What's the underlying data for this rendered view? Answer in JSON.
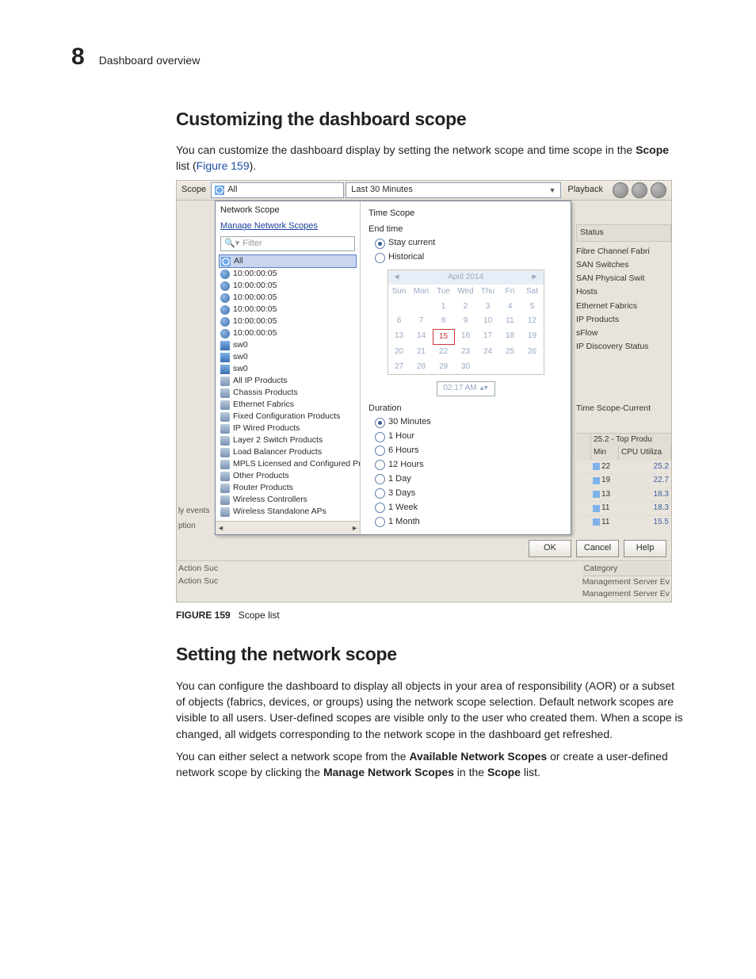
{
  "header": {
    "chapter": "8",
    "title": "Dashboard overview"
  },
  "h2a": "Customizing the dashboard scope",
  "p1a": "You can customize the dashboard display by setting the network scope and time scope in the ",
  "p1b": "Scope",
  "p1c": " list (",
  "p1link": "Figure 159",
  "p1d": ").",
  "fig": {
    "label": "FIGURE 159",
    "caption": "Scope list"
  },
  "h2b": "Setting the network scope",
  "p2": "You can configure the dashboard to display all objects in your area of responsibility (AOR) or a subset of objects (fabrics, devices, or groups) using the network scope selection. Default network scopes are visible to all users. User-defined scopes are visible only to the user who created them. When a scope is changed, all widgets corresponding to the network scope in the dashboard get refreshed.",
  "p3a": "You can either select a network scope from the ",
  "p3b": "Available Network Scopes",
  "p3c": " or create a user-defined network scope by clicking the ",
  "p3d": "Manage Network Scopes",
  "p3e": " in the ",
  "p3f": "Scope",
  "p3g": " list.",
  "ui": {
    "topbar": {
      "scope_label": "Scope",
      "scope_value": "All",
      "time_value": "Last 30 Minutes",
      "playback_label": "Playback"
    },
    "ns": {
      "title": "Network Scope",
      "manage": "Manage Network Scopes",
      "filter_placeholder": "Filter",
      "all": "All",
      "fabrics": [
        "10:00:00:05",
        "10:00:00:05",
        "10:00:00:05",
        "10:00:00:05",
        "10:00:00:05",
        "10:00:00:05"
      ],
      "sw": [
        "sw0",
        "sw0",
        "sw0"
      ],
      "cats": [
        "All IP Products",
        "Chassis Products",
        "Ethernet Fabrics",
        "Fixed Configuration Products",
        "IP Wired Products",
        "Layer 2 Switch Products",
        "Load Balancer Products",
        "MPLS Licensed and Configured Pro",
        "Other Products",
        "Router Products",
        "Wireless Controllers",
        "Wireless Standalone APs"
      ]
    },
    "ts": {
      "title": "Time Scope",
      "endtime": "End time",
      "stay": "Stay current",
      "hist": "Historical",
      "month": "April 2014",
      "dow": [
        "Sun",
        "Mon",
        "Tue",
        "Wed",
        "Thu",
        "Fri",
        "Sat"
      ],
      "weeks": [
        [
          "",
          "",
          "1",
          "2",
          "3",
          "4",
          "5"
        ],
        [
          "6",
          "7",
          "8",
          "9",
          "10",
          "11",
          "12"
        ],
        [
          "13",
          "14",
          "15",
          "16",
          "17",
          "18",
          "19"
        ],
        [
          "20",
          "21",
          "22",
          "23",
          "24",
          "25",
          "26"
        ],
        [
          "27",
          "28",
          "29",
          "30",
          "",
          "",
          ""
        ]
      ],
      "current_day": "15",
      "time": "02:17 AM",
      "duration": "Duration",
      "opts": [
        "30 Minutes",
        "1 Hour",
        "6 Hours",
        "12 Hours",
        "1 Day",
        "3 Days",
        "1 Week",
        "1 Month"
      ],
      "selected": 0
    },
    "right": {
      "status_title": "Status",
      "status_items": [
        "Fibre Channel Fabri",
        "SAN Switches",
        "SAN Physical Swit",
        "Hosts",
        "Ethernet Fabrics",
        "IP Products",
        "sFlow",
        "IP Discovery Status"
      ],
      "timescope": "Time Scope-Current",
      "mini_title": "25.2 - Top Produ",
      "mini_hdr": [
        "",
        "Min",
        "CPU Utiliza"
      ],
      "mini_rows": [
        {
          "min": "22",
          "val": "25.2"
        },
        {
          "min": "19",
          "val": "22.7"
        },
        {
          "min": "13",
          "val": "18.3"
        },
        {
          "min": "11",
          "val": "18.3"
        },
        {
          "min": "11",
          "val": "15.5"
        }
      ]
    },
    "btns": {
      "ok": "OK",
      "cancel": "Cancel",
      "help": "Help"
    },
    "bottom": {
      "left": [
        "ly events",
        "ption",
        "Action Suc",
        "Action Suc"
      ],
      "right": [
        "Category",
        "Management Server Ev",
        "Management Server Ev"
      ]
    }
  }
}
